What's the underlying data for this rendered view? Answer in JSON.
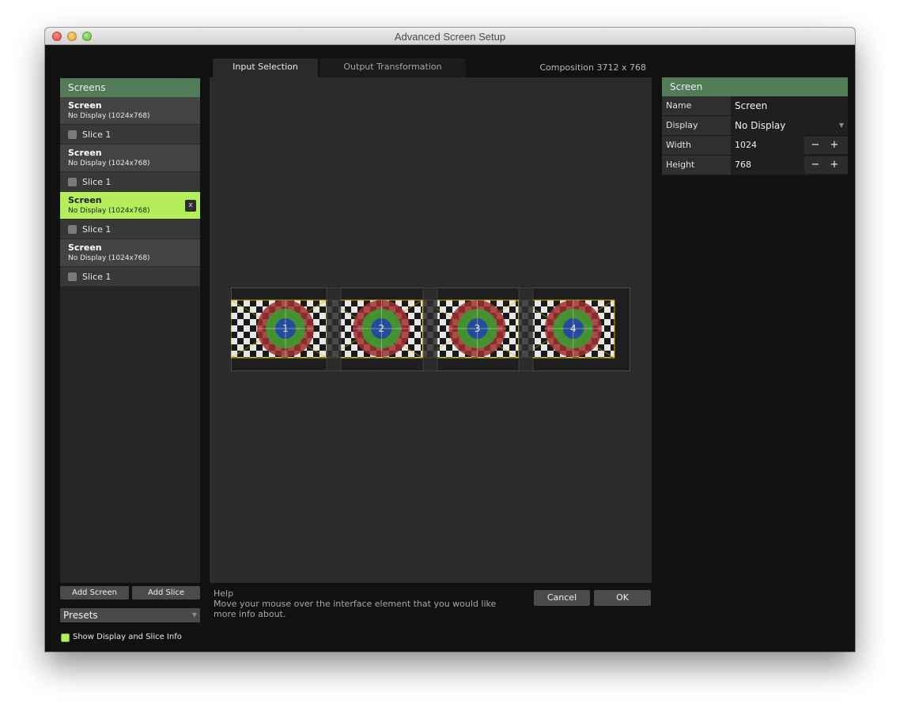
{
  "window": {
    "title": "Advanced Screen Setup"
  },
  "tabs": {
    "input": "Input Selection",
    "output": "Output Transformation"
  },
  "composition": "Composition 3712 x 768",
  "left_panel": {
    "header": "Screens",
    "screens": [
      {
        "name": "Screen",
        "desc": "No Display (1024x768)",
        "slice": "Slice 1"
      },
      {
        "name": "Screen",
        "desc": "No Display (1024x768)",
        "slice": "Slice 1"
      },
      {
        "name": "Screen",
        "desc": "No Display (1024x768)",
        "slice": "Slice 1",
        "remove": "x"
      },
      {
        "name": "Screen",
        "desc": "No Display (1024x768)",
        "slice": "Slice 1"
      }
    ],
    "add_screen": "Add Screen",
    "add_slice": "Add Slice",
    "presets": "Presets",
    "show_info": "Show Display and Slice Info"
  },
  "preview_labels": [
    "1",
    "2",
    "3",
    "4"
  ],
  "help": {
    "title": "Help",
    "text": "Move your mouse over the interface element that you would like more info about."
  },
  "buttons": {
    "cancel": "Cancel",
    "ok": "OK"
  },
  "right_panel": {
    "header": "Screen",
    "name_label": "Name",
    "name_value": "Screen",
    "display_label": "Display",
    "display_value": "No Display",
    "width_label": "Width",
    "width_value": "1024",
    "height_label": "Height",
    "height_value": "768",
    "minus": "−",
    "plus": "+"
  },
  "colors": {
    "accent": "#527c58",
    "selection": "#b4ee5a",
    "background": "#111111"
  }
}
